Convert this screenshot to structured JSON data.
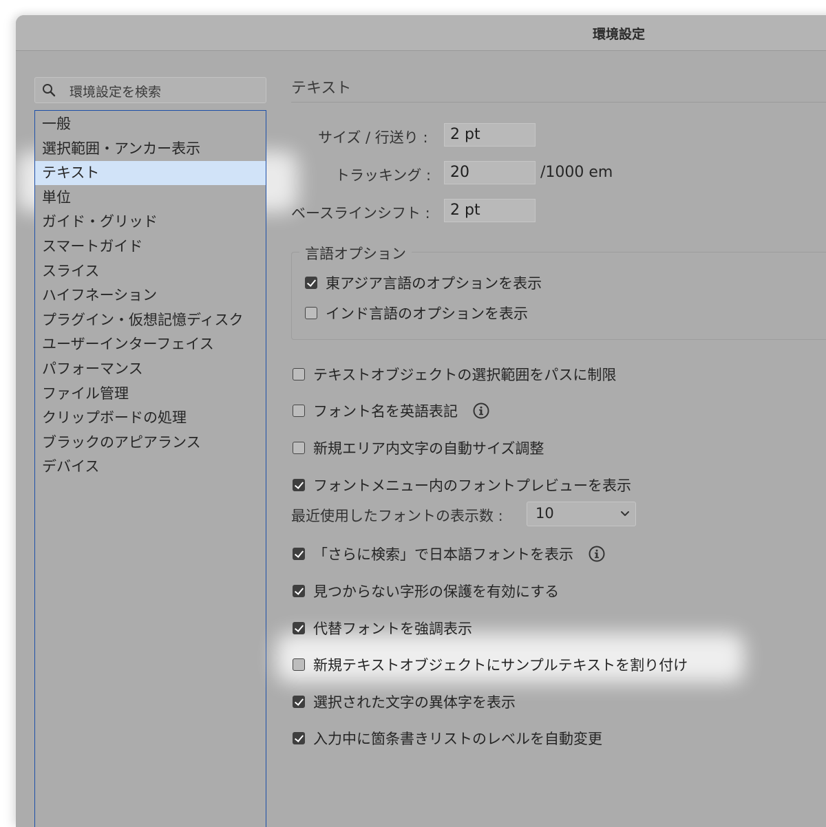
{
  "window": {
    "title": "環境設定"
  },
  "sidebar": {
    "search_placeholder": "環境設定を検索",
    "items": [
      {
        "label": "一般",
        "selected": false
      },
      {
        "label": "選択範囲・アンカー表示",
        "selected": false
      },
      {
        "label": "テキスト",
        "selected": true
      },
      {
        "label": "単位",
        "selected": false
      },
      {
        "label": "ガイド・グリッド",
        "selected": false
      },
      {
        "label": "スマートガイド",
        "selected": false
      },
      {
        "label": "スライス",
        "selected": false
      },
      {
        "label": "ハイフネーション",
        "selected": false
      },
      {
        "label": "プラグイン・仮想記憶ディスク",
        "selected": false
      },
      {
        "label": "ユーザーインターフェイス",
        "selected": false
      },
      {
        "label": "パフォーマンス",
        "selected": false
      },
      {
        "label": "ファイル管理",
        "selected": false
      },
      {
        "label": "クリップボードの処理",
        "selected": false
      },
      {
        "label": "ブラックのアピアランス",
        "selected": false
      },
      {
        "label": "デバイス",
        "selected": false
      }
    ]
  },
  "panel": {
    "title": "テキスト",
    "fields": {
      "size": {
        "label": "サイズ / 行送り :",
        "value": "2 pt"
      },
      "tracking": {
        "label": "トラッキング :",
        "value": "20",
        "unit": "/1000 em"
      },
      "baseline": {
        "label": "ベースラインシフト :",
        "value": "2 pt"
      }
    },
    "language_group": {
      "title": "言語オプション",
      "options": [
        {
          "label": "東アジア言語のオプションを表示",
          "checked": true
        },
        {
          "label": "インド言語のオプションを表示",
          "checked": false
        }
      ]
    },
    "options": [
      {
        "label": "テキストオブジェクトの選択範囲をパスに制限",
        "checked": false,
        "info": false
      },
      {
        "label": "フォント名を英語表記",
        "checked": false,
        "info": true
      },
      {
        "label": "新規エリア内文字の自動サイズ調整",
        "checked": false,
        "info": false
      },
      {
        "label": "フォントメニュー内のフォントプレビューを表示",
        "checked": true,
        "info": false
      },
      {
        "label": "「さらに検索」で日本語フォントを表示",
        "checked": true,
        "info": true
      },
      {
        "label": "見つからない字形の保護を有効にする",
        "checked": true,
        "info": false
      },
      {
        "label": "代替フォントを強調表示",
        "checked": true,
        "info": false
      },
      {
        "label": "新規テキストオブジェクトにサンプルテキストを割り付け",
        "checked": false,
        "info": false
      },
      {
        "label": "選択された文字の異体字を表示",
        "checked": true,
        "info": false
      },
      {
        "label": "入力中に箇条書きリストのレベルを自動変更",
        "checked": true,
        "info": false
      }
    ],
    "recent_fonts": {
      "label": "最近使用したフォントの表示数 :",
      "value": "10"
    }
  },
  "colors": {
    "window_bg": "#acacac",
    "selection": "#d1e3f8",
    "list_border": "#1d4fa8"
  },
  "icons": {
    "search": "search-icon",
    "info": "info-icon",
    "chevron": "chevron-down-icon",
    "check": "checkmark-icon"
  }
}
